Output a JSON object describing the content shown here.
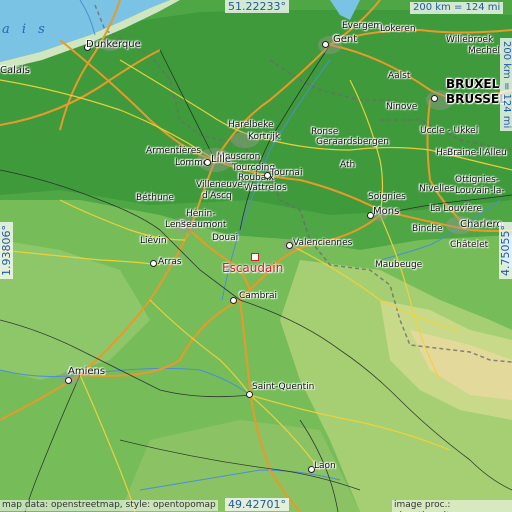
{
  "coordinates": {
    "top": "51.22233°",
    "bottom": "49.42701°",
    "left": "1.93806°",
    "right": "4.75055°"
  },
  "scale": {
    "horizontal": "200 km = 124 mi",
    "vertical": "200 km = 124 mi"
  },
  "target": {
    "name": "Escaudain"
  },
  "sea_label": "a i s",
  "cities": [
    {
      "id": "dunkerque",
      "name": "Dunkerque"
    },
    {
      "id": "calais",
      "name": "Calais"
    },
    {
      "id": "gent",
      "name": "Gent"
    },
    {
      "id": "evergem",
      "name": "Evergem"
    },
    {
      "id": "lokeren",
      "name": "Lokeren"
    },
    {
      "id": "willebroek",
      "name": "Willebroek"
    },
    {
      "id": "mechelen",
      "name": "Mechel"
    },
    {
      "id": "aalst",
      "name": "Aalst"
    },
    {
      "id": "bruxelles1",
      "name": "BRUXEL"
    },
    {
      "id": "bruxelles2",
      "name": "BRUSSEL"
    },
    {
      "id": "ninove",
      "name": "Ninove"
    },
    {
      "id": "uccle",
      "name": "Uccle - Ukkel"
    },
    {
      "id": "harelbeke",
      "name": "Harelbeke"
    },
    {
      "id": "kortrijk",
      "name": "Kortrijk"
    },
    {
      "id": "mouscron",
      "name": "Mouscron"
    },
    {
      "id": "tourcoing",
      "name": "Tourcoing"
    },
    {
      "id": "roubaix",
      "name": "Roubaix"
    },
    {
      "id": "wattrelos",
      "name": "Wattrelos"
    },
    {
      "id": "ronse",
      "name": "Ronse"
    },
    {
      "id": "geraardsbergen",
      "name": "Geraardsbergen"
    },
    {
      "id": "halle",
      "name": "Halle"
    },
    {
      "id": "braine",
      "name": "Braine-l'Alleu"
    },
    {
      "id": "armentieres",
      "name": "Armentières"
    },
    {
      "id": "lomme",
      "name": "Lomme"
    },
    {
      "id": "lille",
      "name": "Lille"
    },
    {
      "id": "villeneuve",
      "name": "Villeneuve-"
    },
    {
      "id": "dascq",
      "name": "d'Ascq"
    },
    {
      "id": "tournai",
      "name": "Tournai"
    },
    {
      "id": "ath",
      "name": "Ath"
    },
    {
      "id": "soignies",
      "name": "Soignies"
    },
    {
      "id": "nivelles",
      "name": "Nivelles"
    },
    {
      "id": "ottignies",
      "name": "Ottignies-"
    },
    {
      "id": "louvain",
      "name": "Louvain-la-"
    },
    {
      "id": "lalouviere",
      "name": "La Louvière"
    },
    {
      "id": "charleroi",
      "name": "Charlero"
    },
    {
      "id": "chatelet",
      "name": "Châtelet"
    },
    {
      "id": "binche",
      "name": "Binche"
    },
    {
      "id": "mons",
      "name": "Mons"
    },
    {
      "id": "bethune",
      "name": "Béthune"
    },
    {
      "id": "henin",
      "name": "Hénin-"
    },
    {
      "id": "beaumont",
      "name": "Beaumont"
    },
    {
      "id": "lens",
      "name": "Lens"
    },
    {
      "id": "lievin",
      "name": "Liévin"
    },
    {
      "id": "douai",
      "name": "Douai"
    },
    {
      "id": "valenciennes",
      "name": "Valenciennes"
    },
    {
      "id": "maubeuge",
      "name": "Maubeuge"
    },
    {
      "id": "arras",
      "name": "Arras"
    },
    {
      "id": "cambrai",
      "name": "Cambrai"
    },
    {
      "id": "amiens",
      "name": "Amiens"
    },
    {
      "id": "saintquentin",
      "name": "Saint-Quentin"
    },
    {
      "id": "laon",
      "name": "Laon"
    }
  ],
  "attribution": {
    "left": "map data: openstreetmap, style: opentopomap",
    "right": "image proc.: elevation.city"
  }
}
